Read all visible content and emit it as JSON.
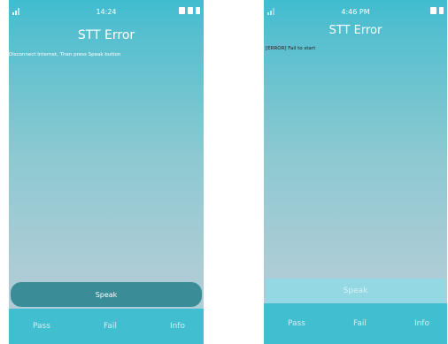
{
  "screens": [
    {
      "clock": "14:24",
      "title": "STT Error",
      "message": "Disconnect Internet, Then press Speak button",
      "speak_label": "Speak",
      "pass_label": "Pass",
      "fail_label": "Fail",
      "info_label": "Info"
    },
    {
      "clock": "4:46 PM",
      "title": "STT Error",
      "message": "[ERROR] Fail to start",
      "speak_label": "Speak",
      "pass_label": "Pass",
      "fail_label": "Fail",
      "info_label": "Info"
    }
  ],
  "colors": {
    "header": "#3fbcd0",
    "speak_active": "#3a8c96",
    "speak_disabled": "#93d8e3",
    "bottom_bar": "#41bfd1"
  },
  "icons": [
    "signal-icon",
    "sim-icon",
    "battery-icon",
    "alarm-icon"
  ]
}
